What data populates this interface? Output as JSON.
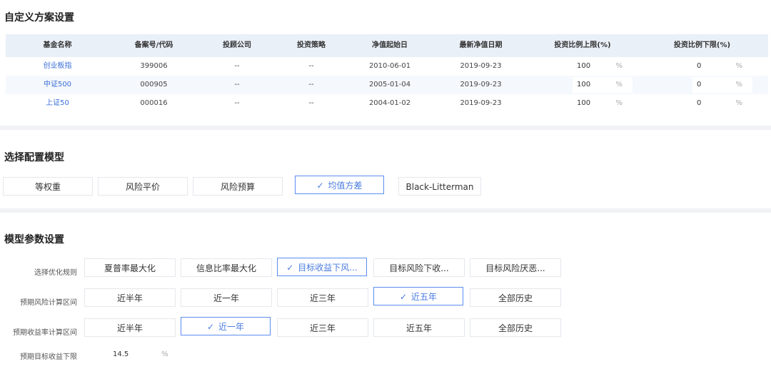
{
  "section1": {
    "title": "自定义方案设置",
    "headers": [
      "基金名称",
      "备案号/代码",
      "投顾公司",
      "投资策略",
      "净值起始日",
      "最新净值日期",
      "投资比例上限(%)",
      "投资比例下限(%)"
    ],
    "rows": [
      {
        "name": "创业板指",
        "code": "399006",
        "advisor": "--",
        "strategy": "--",
        "start": "2010-06-01",
        "latest": "2019-09-23",
        "upper": "100",
        "lower": "0"
      },
      {
        "name": "中证500",
        "code": "000905",
        "advisor": "--",
        "strategy": "--",
        "start": "2005-01-04",
        "latest": "2019-09-23",
        "upper": "100",
        "lower": "0"
      },
      {
        "name": "上证50",
        "code": "000016",
        "advisor": "--",
        "strategy": "--",
        "start": "2004-01-02",
        "latest": "2019-09-23",
        "upper": "100",
        "lower": "0"
      }
    ],
    "pct_unit": "%"
  },
  "section2": {
    "title": "选择配置模型",
    "models": [
      "等权重",
      "风险平价",
      "风险预算",
      "均值方差",
      "Black-Litterman"
    ],
    "selected": 3
  },
  "section3": {
    "title": "模型参数设置",
    "rule_label": "选择优化规则",
    "rules": [
      "夏普率最大化",
      "信息比率最大化",
      "目标收益下风...",
      "目标风险下收...",
      "目标风险厌恶..."
    ],
    "rule_selected": 2,
    "risk_label": "预期风险计算区间",
    "risk_options": [
      "近半年",
      "近一年",
      "近三年",
      "近五年",
      "全部历史"
    ],
    "risk_selected": 3,
    "return_label": "预期收益率计算区间",
    "return_options": [
      "近半年",
      "近一年",
      "近三年",
      "近五年",
      "全部历史"
    ],
    "return_selected": 1,
    "target_label": "预期目标收益下限",
    "target_value": "14.5",
    "target_unit": "%"
  },
  "colors": {
    "accent": "#5b8def",
    "link": "#3a6fd8",
    "header_bg": "#eaf0f8",
    "divider": "#f0f2f5"
  }
}
